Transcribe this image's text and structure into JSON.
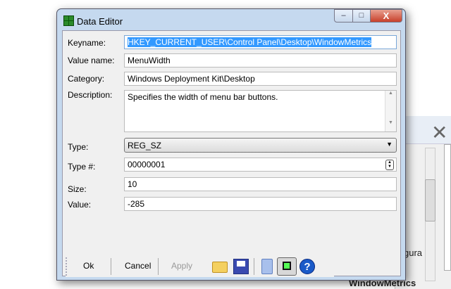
{
  "window": {
    "title": "Data Editor",
    "min": "–",
    "max": "□",
    "close": "X"
  },
  "fields": {
    "keyname_label": "Keyname:",
    "keyname": "HKEY_CURRENT_USER\\Control Panel\\Desktop\\WindowMetrics",
    "valuename_label": "Value name:",
    "valuename": "MenuWidth",
    "category_label": "Category:",
    "category": "Windows Deployment Kit\\Desktop",
    "description_label": "Description:",
    "description": "Specifies the width of menu bar buttons.",
    "type_label": "Type:",
    "type": "REG_SZ",
    "typenum_label": "Type #:",
    "typenum": "00000001",
    "size_label": "Size:",
    "size": "10",
    "value_label": "Value:",
    "value": "-285"
  },
  "toolbar": {
    "ok": "Ok",
    "cancel": "Cancel",
    "apply": "Apply"
  },
  "background": {
    "text1": "gura",
    "text2": "WindowMetrics"
  }
}
